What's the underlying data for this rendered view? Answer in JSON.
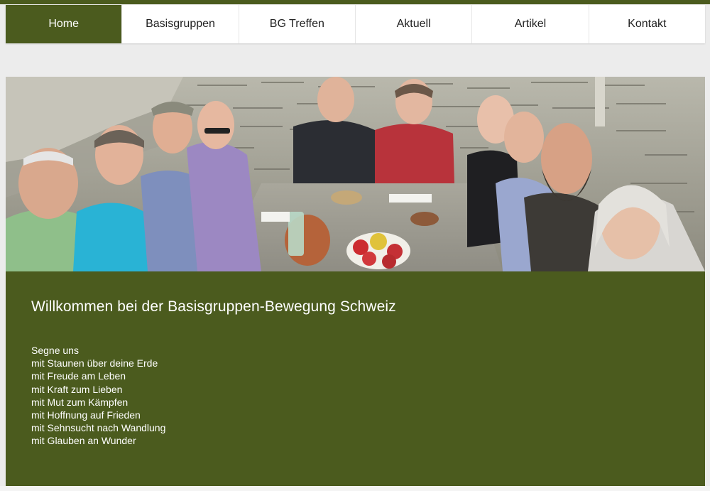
{
  "nav": {
    "items": [
      {
        "label": "Home",
        "active": true
      },
      {
        "label": "Basisgruppen",
        "active": false
      },
      {
        "label": "BG Treffen",
        "active": false
      },
      {
        "label": "Aktuell",
        "active": false
      },
      {
        "label": "Artikel",
        "active": false
      },
      {
        "label": "Kontakt",
        "active": false
      }
    ]
  },
  "welcome": {
    "title": "Willkommen bei der Basisgruppen-Bewegung Schweiz",
    "lines": [
      "Segne uns",
      "mit Staunen über deine Erde",
      "mit Freude am Leben",
      "mit Kraft zum Lieben",
      "mit Mut zum Kämpfen",
      "mit Hoffnung auf Frieden",
      "mit Sehnsucht nach Wandlung",
      "mit Glauben an Wunder"
    ]
  },
  "colors": {
    "brand_green": "#4b5b1e",
    "nav_bg": "#ffffff",
    "page_bg": "#ececec"
  }
}
